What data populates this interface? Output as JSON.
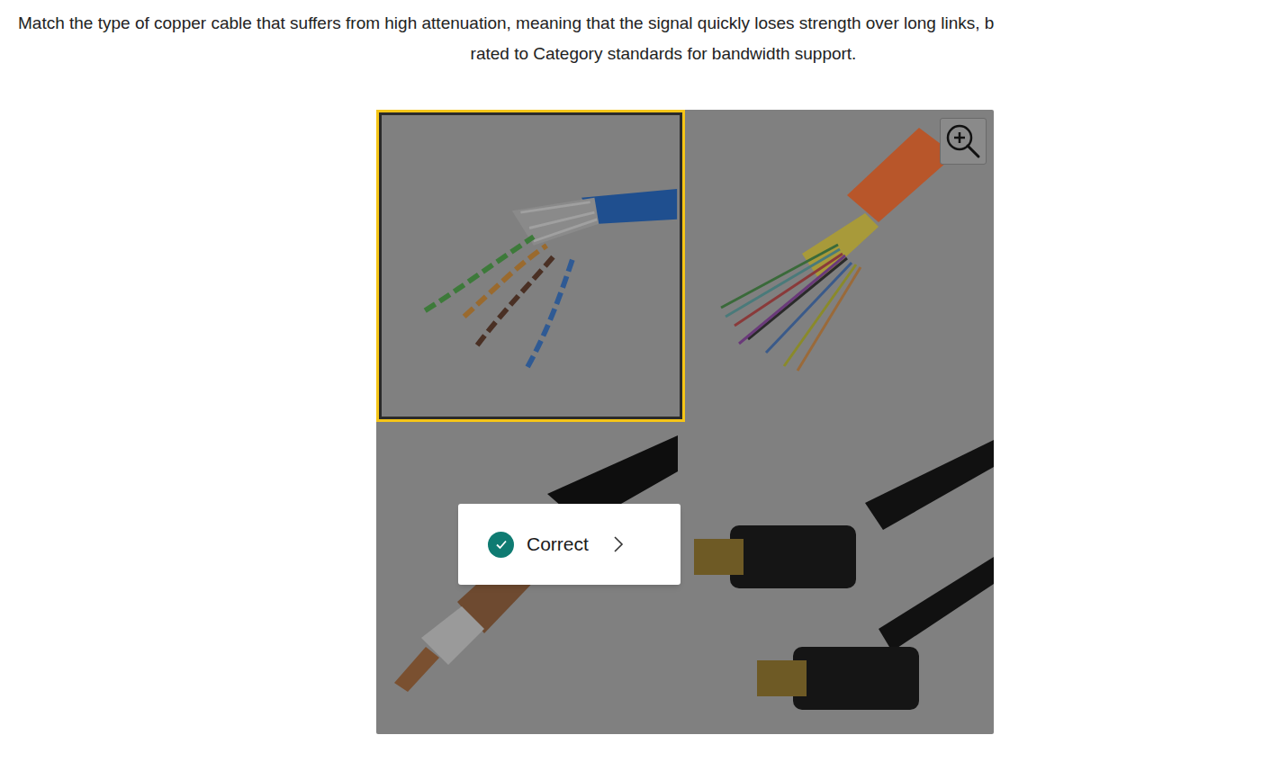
{
  "question": {
    "lines": [
      "Match the type of copper cable that suffers from high attenuation, meaning that the signal quickly loses strength over long links, b",
      "rated to Category standards for bandwidth support."
    ]
  },
  "tiles": [
    {
      "kind": "twisted-pair",
      "selected": true
    },
    {
      "kind": "fiber",
      "selected": false
    },
    {
      "kind": "coax",
      "selected": false
    },
    {
      "kind": "hdmi",
      "selected": false
    }
  ],
  "feedback": {
    "label": "Correct",
    "correct": true
  }
}
